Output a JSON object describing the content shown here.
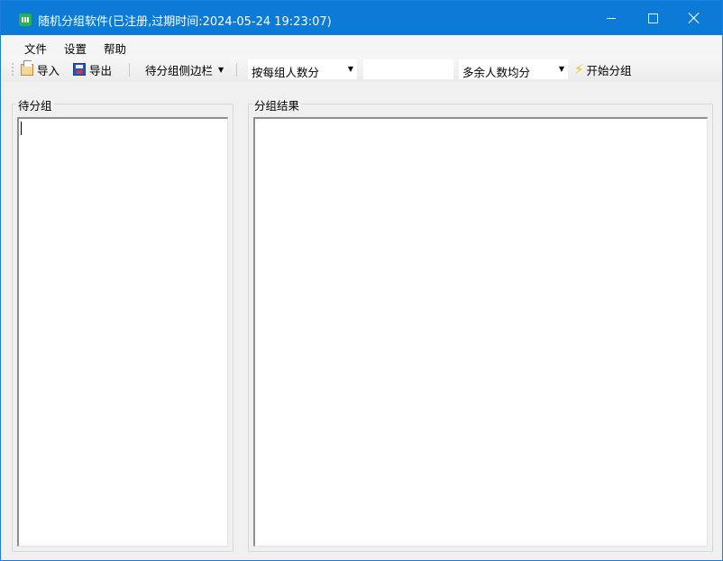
{
  "window": {
    "title": "随机分组软件(已注册,过期时间:2024-05-24 19:23:07)",
    "accent_color": "#0c7bd8"
  },
  "menu": {
    "items": [
      {
        "label": "文件"
      },
      {
        "label": "设置"
      },
      {
        "label": "帮助"
      }
    ]
  },
  "toolbar": {
    "import_label": "导入",
    "import_icon": "import-folder-icon",
    "export_label": "导出",
    "export_icon": "save-disk-icon",
    "sidebar_dropdown_label": "待分组侧边栏",
    "mode_select_value": "按每组人数分",
    "count_input_value": "",
    "remainder_select_value": "多余人数均分",
    "start_label": "开始分组",
    "start_icon": "lightning-icon"
  },
  "panels": {
    "pending_label": "待分组",
    "pending_text": "",
    "result_label": "分组结果",
    "result_text": ""
  }
}
